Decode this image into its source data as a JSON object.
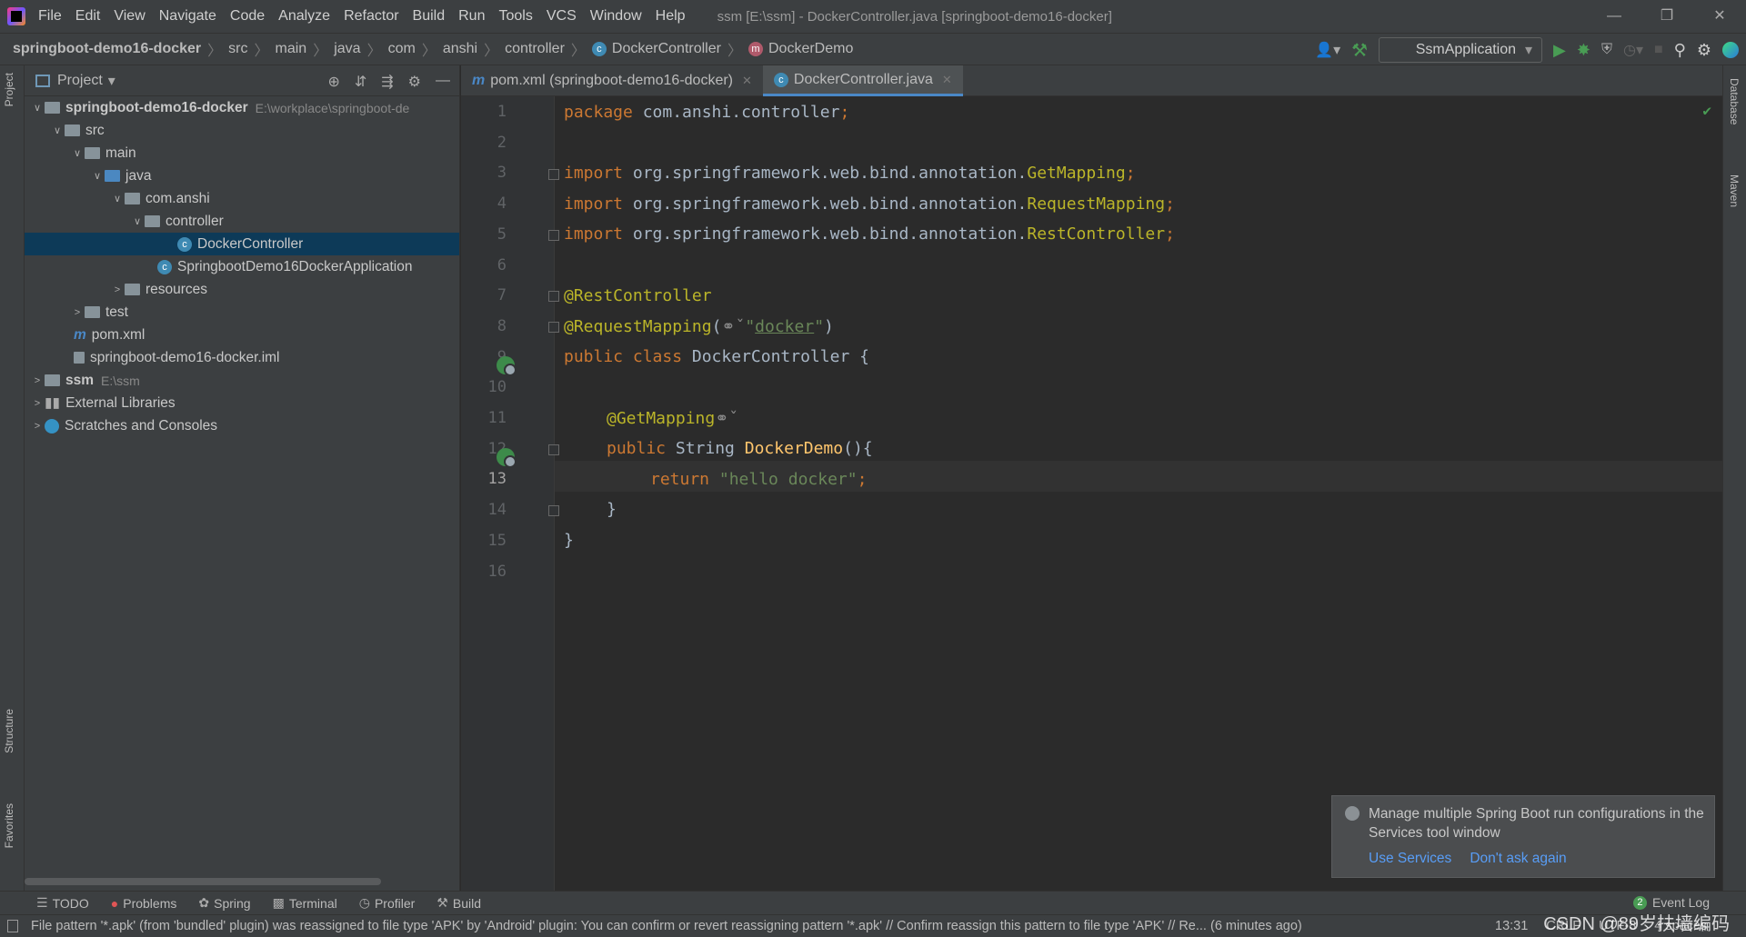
{
  "menu": {
    "items": [
      "File",
      "Edit",
      "View",
      "Navigate",
      "Code",
      "Analyze",
      "Refactor",
      "Build",
      "Run",
      "Tools",
      "VCS",
      "Window",
      "Help"
    ],
    "window_title": "ssm [E:\\ssm] - DockerController.java [springboot-demo16-docker]"
  },
  "breadcrumb": {
    "items": [
      "springboot-demo16-docker",
      "src",
      "main",
      "java",
      "com",
      "anshi",
      "controller",
      "DockerController",
      "DockerDemo"
    ]
  },
  "toolbar": {
    "run_config": "SsmApplication"
  },
  "project": {
    "title": "Project",
    "tree": [
      {
        "label": "springboot-demo16-docker",
        "extra": "E:\\workplace\\springboot-de"
      },
      {
        "label": "src"
      },
      {
        "label": "main"
      },
      {
        "label": "java"
      },
      {
        "label": "com.anshi"
      },
      {
        "label": "controller"
      },
      {
        "label": "DockerController"
      },
      {
        "label": "SpringbootDemo16DockerApplication"
      },
      {
        "label": "resources"
      },
      {
        "label": "test"
      },
      {
        "label": "pom.xml"
      },
      {
        "label": "springboot-demo16-docker.iml"
      },
      {
        "label": "ssm",
        "extra": "E:\\ssm"
      },
      {
        "label": "External Libraries"
      },
      {
        "label": "Scratches and Consoles"
      }
    ]
  },
  "tabs": [
    {
      "label": "pom.xml (springboot-demo16-docker)"
    },
    {
      "label": "DockerController.java"
    }
  ],
  "editor": {
    "current_line": 13,
    "lines": [
      "1",
      "2",
      "3",
      "4",
      "5",
      "6",
      "7",
      "8",
      "9",
      "10",
      "11",
      "12",
      "13",
      "14",
      "15",
      "16"
    ],
    "code": {
      "pkg_kw": "package",
      "pkg": " com.anshi.controller",
      "semi": ";",
      "imp": "import",
      "imp1": " org.springframework.web.bind.annotation.",
      "c1": "GetMapping",
      "imp2": " org.springframework.web.bind.annotation.",
      "c2": "RequestMapping",
      "imp3": " org.springframework.web.bind.annotation.",
      "c3": "RestController",
      "a1": "@RestController",
      "a2": "@RequestMapping",
      "a2_open": "(",
      "q": "\"",
      "a2_val": "docker",
      "a2_close": ")",
      "cls_kw": "public class",
      "cls": " DockerController {",
      "a3": "@GetMapping",
      "m_kw": "public",
      "m_type": " String ",
      "m_name": "DockerDemo",
      "m_rest": "(){",
      "ret_kw": "return",
      "ret_str": " \"hello docker\"",
      "close1": "}",
      "close2": "}"
    }
  },
  "side": {
    "left_top": "Project",
    "left_structure": "Structure",
    "left_favorites": "Favorites",
    "right_db": "Database",
    "right_maven": "Maven"
  },
  "notification": {
    "message": "Manage multiple Spring Boot run configurations in the Services tool window",
    "action1": "Use Services",
    "action2": "Don't ask again"
  },
  "bottom_tools": [
    "TODO",
    "Problems",
    "Spring",
    "Terminal",
    "Profiler",
    "Build"
  ],
  "event_log": {
    "label": "Event Log",
    "count": "2"
  },
  "status": {
    "message": "File pattern '*.apk' (from 'bundled' plugin) was reassigned to file type 'APK' by 'Android' plugin: You can confirm or revert reassigning pattern '*.apk' // Confirm reassign this pattern to file type 'APK' // Re... (6 minutes ago)",
    "time": "13:31",
    "line_sep": "CRLF",
    "encoding": "UTF-8",
    "indent": "4 spaces"
  },
  "watermark": "CSDN @89岁扶墙编码"
}
